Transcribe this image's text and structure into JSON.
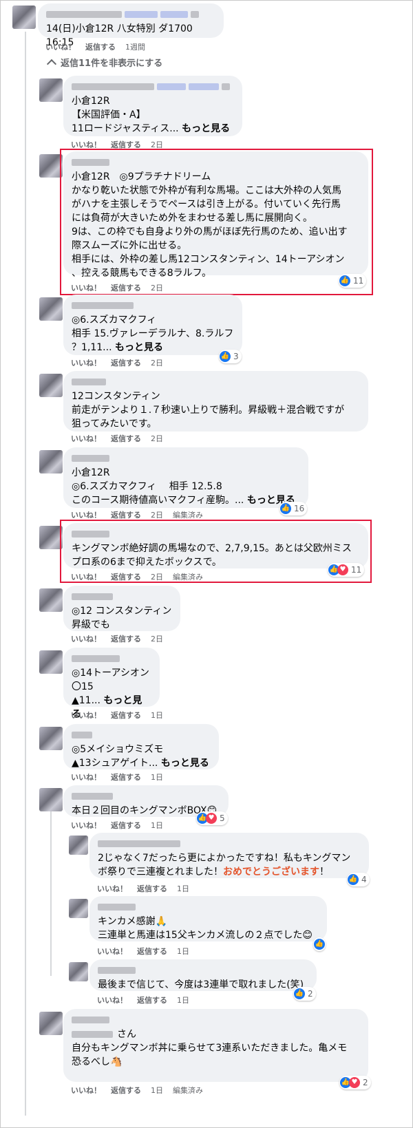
{
  "comments": [
    {
      "text": "14(日)小倉12R 八女特別 ダ1700 16:15",
      "like": "いいね！",
      "reply": "返信する",
      "time": "1週間"
    },
    {
      "text": "小倉12R\n【米国評価・A】\n11ロードジャスティス...",
      "more": "もっと見る",
      "like": "いいね！",
      "reply": "返信する",
      "time": "2日"
    },
    {
      "text": "小倉12R　◎9プラチナドリーム\nかなり乾いた状態で外枠が有利な馬場。ここは大外枠の人気馬\nがハナを主張しそうでペースは引き上がる。付いていく先行馬\nには負荷が大きいため外をまわせる差し馬に展開向く。\n9は、この枠でも自身より外の馬がほぼ先行馬のため、追い出す\n際スムーズに外に出せる。\n相手には、外枠の差し馬12コンスタンティン、14トーアシオン\n、控える競馬もできる8ラルフ。",
      "like": "いいね！",
      "reply": "返信する",
      "time": "2日",
      "reactions": "11"
    },
    {
      "text": "◎6.スズカマクフィ\n相手 15.ヴァレーデラルナ、8.ラルフ\n？1,11...",
      "more": "もっと見る",
      "like": "いいね！",
      "reply": "返信する",
      "time": "2日",
      "reactions": "3"
    },
    {
      "text": "12コンスタンティン\n前走がテンより１.７秒速い上りで勝利。昇級戦＋混合戦ですが\n狙ってみたいです。",
      "like": "いいね！",
      "reply": "返信する",
      "time": "2日"
    },
    {
      "text": "小倉12R\n◎6.スズカマクフィ　 相手 12.5.8\nこのコース期待値高いマクフィ産駒。...",
      "more": "もっと見る",
      "like": "いいね！",
      "reply": "返信する",
      "time": "2日",
      "edited": "編集済み",
      "reactions": "16"
    },
    {
      "text": "キングマンボ絶好調の馬場なので、2,7,9,15。あとは父欧州ミス\nプロ系の6まで抑えたボックスで。",
      "like": "いいね！",
      "reply": "返信する",
      "time": "2日",
      "edited": "編集済み",
      "reactions": "11"
    },
    {
      "text": "◎12 コンスタンティン\n昇級でも",
      "like": "いいね！",
      "reply": "返信する",
      "time": "2日"
    },
    {
      "text": "◎14トーアシオン\n〇15\n▲11...",
      "more": "もっと見る",
      "like": "いいね！",
      "reply": "返信する",
      "time": "1日"
    },
    {
      "text": "◎5メイショウミズモ\n▲13シュアゲイト...",
      "more": "もっと見る",
      "like": "いいね！",
      "reply": "返信する",
      "time": "1日"
    },
    {
      "text": "本日２回目のキングマンボBOX😊",
      "like": "いいね！",
      "reply": "返信する",
      "time": "1日",
      "reactions": "5"
    },
    {
      "text": "2じゃなく7だったら更によかったですね！私もキングマン\nボ祭りで三連複とれました！",
      "highlight": "おめでとうございます",
      "tail": "！",
      "like": "いいね！",
      "reply": "返信する",
      "time": "1日",
      "reactions": "4"
    },
    {
      "text": "キンカメ感謝🙏\n三連単と馬連は15父キンカメ流しの２点でした😊",
      "like": "いいね！",
      "reply": "返信する",
      "time": "1日"
    },
    {
      "text": "最後まで信じて、今度は3連単で取れました(笑)",
      "like": "いいね！",
      "reply": "返信する",
      "time": "1日",
      "reactions": "2"
    },
    {
      "mention_suffix": "さん",
      "text": "自分もキングマンボ丼に乗らせて3連系いただきました。亀メモ\n恐るべし🐴",
      "like": "いいね！",
      "reply": "返信する",
      "time": "1日",
      "edited": "編集済み",
      "reactions": "2"
    }
  ],
  "toggle_label": "返信11件を非表示にする",
  "toggle_icon": "chevron-up-icon",
  "colors": {
    "accent": "#1877f2",
    "love": "#f33e58",
    "highlight_border": "#e2183c",
    "orange": "#e4552c"
  }
}
